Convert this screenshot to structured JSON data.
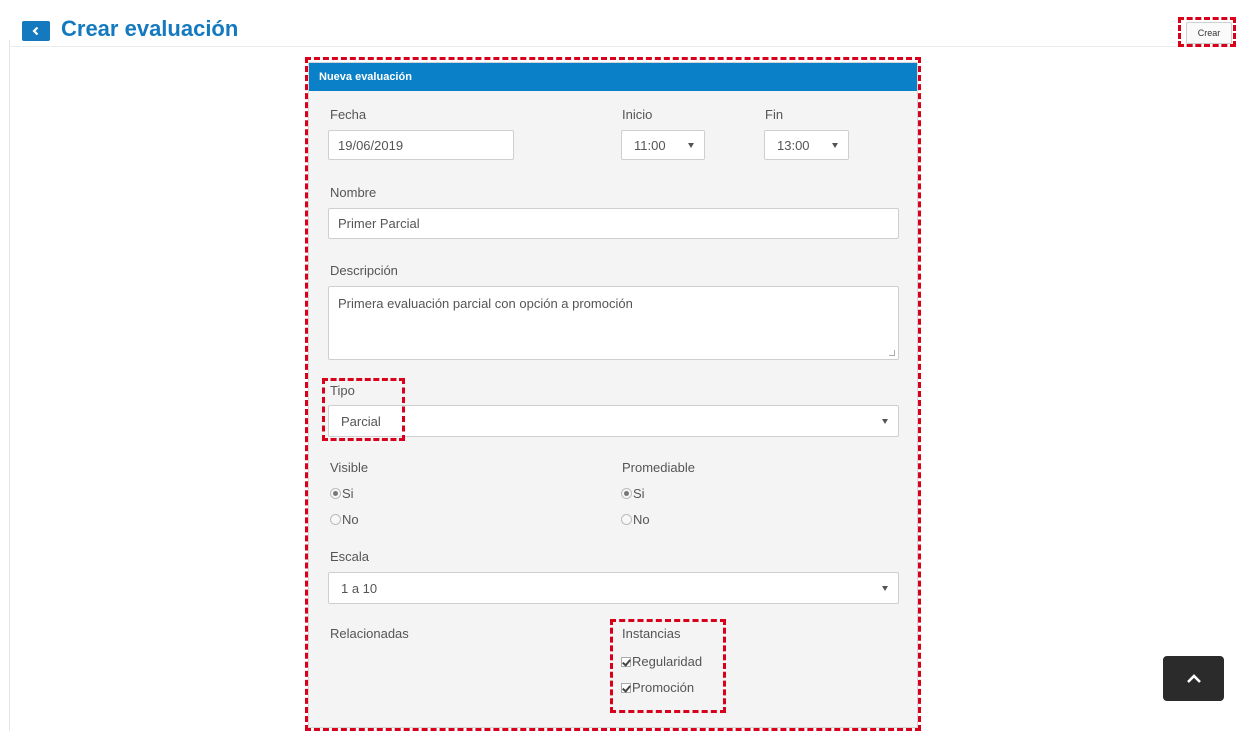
{
  "header": {
    "title": "Crear evaluación",
    "create_label": "Crear",
    "back_icon": "chevron-left-icon"
  },
  "panel": {
    "title": "Nueva evaluación",
    "fecha": {
      "label": "Fecha",
      "value": "19/06/2019"
    },
    "inicio": {
      "label": "Inicio",
      "value": "11:00"
    },
    "fin": {
      "label": "Fin",
      "value": "13:00"
    },
    "nombre": {
      "label": "Nombre",
      "value": "Primer Parcial"
    },
    "descripcion": {
      "label": "Descripción",
      "value": "Primera evaluación parcial con opción a promoción"
    },
    "tipo": {
      "label": "Tipo",
      "value": "Parcial"
    },
    "visible": {
      "label": "Visible",
      "options": [
        "Si",
        "No"
      ],
      "selected": "Si"
    },
    "promediable": {
      "label": "Promediable",
      "options": [
        "Si",
        "No"
      ],
      "selected": "Si"
    },
    "escala": {
      "label": "Escala",
      "value": "1 a 10"
    },
    "relacionadas": {
      "label": "Relacionadas"
    },
    "instancias": {
      "label": "Instancias",
      "items": [
        {
          "label": "Regularidad",
          "checked": true
        },
        {
          "label": "Promoción",
          "checked": true
        }
      ]
    }
  },
  "scroll_top_icon": "chevron-up-icon",
  "colors": {
    "accent": "#1479bf",
    "panel_header": "#0a80c8",
    "highlight": "#d9001b"
  }
}
